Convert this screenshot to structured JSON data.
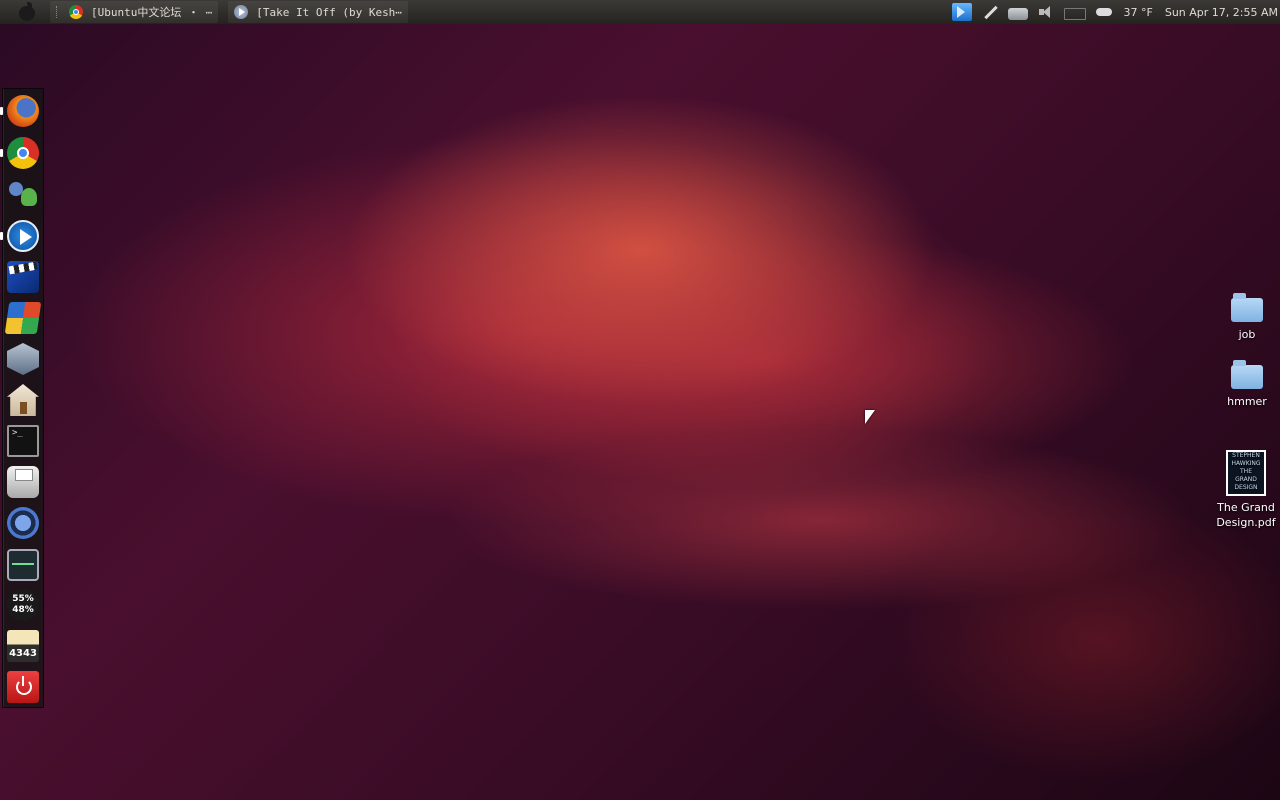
{
  "top_panel": {
    "tasks": [
      {
        "label": "[Ubuntu中文论坛 ・ ⋯"
      },
      {
        "label": "[Take It Off (by Kesh⋯"
      }
    ],
    "weather_temp": "37 °F",
    "clock": "Sun Apr 17,  2:55 AM"
  },
  "dock": {
    "items": [
      {
        "name": "firefox-icon"
      },
      {
        "name": "chrome-icon"
      },
      {
        "name": "messenger-icon"
      },
      {
        "name": "media-player-icon"
      },
      {
        "name": "video-editor-icon"
      },
      {
        "name": "wine-icon"
      },
      {
        "name": "virtualbox-icon"
      },
      {
        "name": "home-folder-icon"
      },
      {
        "name": "terminal-icon"
      },
      {
        "name": "printer-icon"
      },
      {
        "name": "update-manager-icon"
      },
      {
        "name": "system-monitor-icon"
      },
      {
        "name": "cpu-ram-stats-icon"
      },
      {
        "name": "stash-icon"
      },
      {
        "name": "power-icon"
      }
    ],
    "stats": {
      "cpu": "55%",
      "ram": "48%"
    },
    "stash_count": "4343"
  },
  "desktop": {
    "icons": [
      {
        "label": "job"
      },
      {
        "label": "hmmer"
      },
      {
        "label": "The Grand Design.pdf",
        "thumb_lines": [
          "STEPHEN",
          "HAWKING",
          "THE",
          "GRAND",
          "DESIGN"
        ]
      }
    ]
  }
}
